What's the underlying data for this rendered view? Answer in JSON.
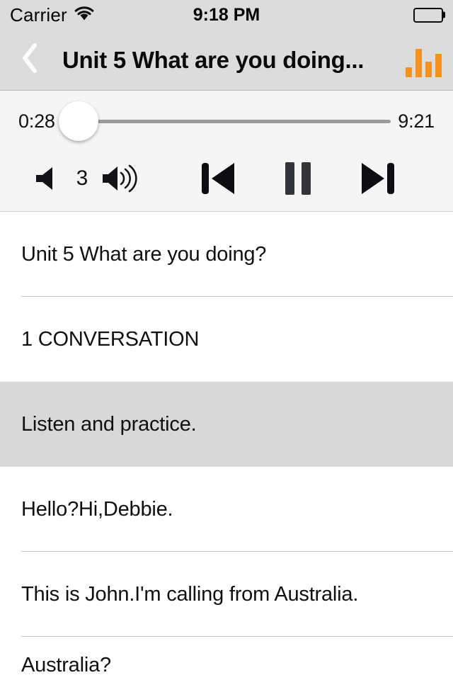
{
  "status_bar": {
    "carrier": "Carrier",
    "wifi_icon": "wifi-icon",
    "time": "9:18 PM",
    "battery_icon": "battery-full-icon"
  },
  "nav_bar": {
    "back_icon": "chevron-left-icon",
    "title": "Unit 5 What are you doing...",
    "equalizer_icon": "equalizer-bars-icon",
    "equalizer_color": "#f7911e",
    "equalizer_bar_heights": [
      14,
      40,
      22,
      33
    ]
  },
  "player": {
    "elapsed_time": "0:28",
    "total_time": "9:21",
    "progress_percent": 5,
    "track_color": "#9b9b9b",
    "fill_color": "#1f9ed9",
    "thumb_color": "#ffffff",
    "controls": {
      "volume_down_icon": "volume-down-icon",
      "volume_level": "3",
      "volume_up_icon": "volume-up-icon",
      "previous_icon": "previous-track-icon",
      "pause_icon": "pause-icon",
      "next_icon": "next-track-icon"
    }
  },
  "list": {
    "rows": [
      {
        "text": "Unit 5 What are you doing?",
        "highlighted": false
      },
      {
        "text": "1 CONVERSATION",
        "highlighted": false
      },
      {
        "text": "Listen and practice.",
        "highlighted": true
      },
      {
        "text": "Hello?Hi,Debbie.",
        "highlighted": false
      },
      {
        "text": "This is John.I'm calling from Australia.",
        "highlighted": false
      },
      {
        "text": "Australia?",
        "highlighted": false
      }
    ]
  }
}
